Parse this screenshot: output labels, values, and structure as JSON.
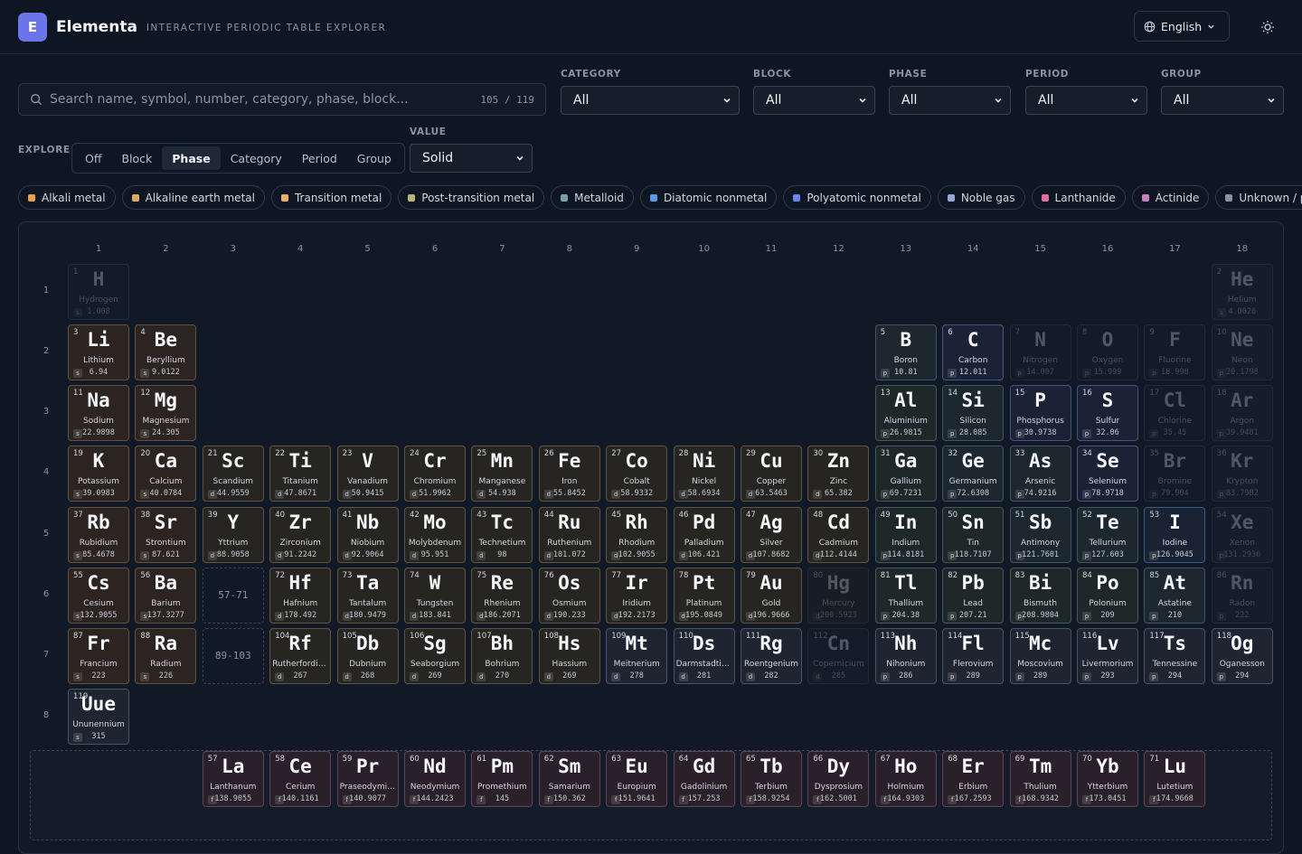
{
  "app": {
    "logo_letter": "E",
    "name": "Elementa",
    "tagline": "INTERACTIVE PERIODIC TABLE EXPLORER",
    "language": "English",
    "theme_icon": "sun-icon"
  },
  "search": {
    "placeholder": "Search name, symbol, number, category, phase, block...",
    "shown": "105",
    "sep": "/",
    "total": "119"
  },
  "filters": [
    {
      "label": "CATEGORY",
      "value": "All"
    },
    {
      "label": "BLOCK",
      "value": "All"
    },
    {
      "label": "PHASE",
      "value": "All"
    },
    {
      "label": "PERIOD",
      "value": "All"
    },
    {
      "label": "GROUP",
      "value": "All"
    }
  ],
  "explore": {
    "label": "EXPLORE",
    "options": [
      "Off",
      "Block",
      "Phase",
      "Category",
      "Period",
      "Group"
    ],
    "active": "Phase",
    "value_label": "VALUE",
    "value": "Solid"
  },
  "legend": [
    {
      "label": "Alkali metal",
      "color": "#e8a054"
    },
    {
      "label": "Alkaline earth metal",
      "color": "#e0a860"
    },
    {
      "label": "Transition metal",
      "color": "#e6b06a"
    },
    {
      "label": "Post-transition metal",
      "color": "#b7b576"
    },
    {
      "label": "Metalloid",
      "color": "#7e9bb0"
    },
    {
      "label": "Diatomic nonmetal",
      "color": "#5a9be6"
    },
    {
      "label": "Polyatomic nonmetal",
      "color": "#6a86e8"
    },
    {
      "label": "Noble gas",
      "color": "#9aa6d8"
    },
    {
      "label": "Lanthanide",
      "color": "#e06b9c"
    },
    {
      "label": "Actinide",
      "color": "#c97fbf"
    },
    {
      "label": "Unknown / predicted",
      "color": "#8b93a3"
    }
  ],
  "group_numbers": [
    "1",
    "2",
    "3",
    "4",
    "5",
    "6",
    "7",
    "8",
    "9",
    "10",
    "11",
    "12",
    "13",
    "14",
    "15",
    "16",
    "17",
    "18"
  ],
  "period_numbers": [
    "1",
    "2",
    "3",
    "4",
    "5",
    "6",
    "7",
    "8"
  ],
  "placeholders": [
    {
      "label": "57-71",
      "period": 6
    },
    {
      "label": "89-103",
      "period": 7
    }
  ],
  "elements": [
    {
      "z": "1",
      "sym": "H",
      "name": "Hydrogen",
      "mass": "1.008",
      "block": "s",
      "cat": "dnm",
      "g": 1,
      "p": 1,
      "dim": true
    },
    {
      "z": "2",
      "sym": "He",
      "name": "Helium",
      "mass": "4.0026",
      "block": "s",
      "cat": "noble",
      "g": 18,
      "p": 1,
      "dim": true
    },
    {
      "z": "3",
      "sym": "Li",
      "name": "Lithium",
      "mass": "6.94",
      "block": "s",
      "cat": "alk",
      "g": 1,
      "p": 2
    },
    {
      "z": "4",
      "sym": "Be",
      "name": "Beryllium",
      "mass": "9.0122",
      "block": "s",
      "cat": "ae",
      "g": 2,
      "p": 2
    },
    {
      "z": "5",
      "sym": "B",
      "name": "Boron",
      "mass": "10.81",
      "block": "p",
      "cat": "met",
      "g": 13,
      "p": 2
    },
    {
      "z": "6",
      "sym": "C",
      "name": "Carbon",
      "mass": "12.011",
      "block": "p",
      "cat": "pnm",
      "g": 14,
      "p": 2
    },
    {
      "z": "7",
      "sym": "N",
      "name": "Nitrogen",
      "mass": "14.007",
      "block": "p",
      "cat": "dnm",
      "g": 15,
      "p": 2,
      "dim": true
    },
    {
      "z": "8",
      "sym": "O",
      "name": "Oxygen",
      "mass": "15.999",
      "block": "p",
      "cat": "dnm",
      "g": 16,
      "p": 2,
      "dim": true
    },
    {
      "z": "9",
      "sym": "F",
      "name": "Fluorine",
      "mass": "18.998",
      "block": "p",
      "cat": "dnm",
      "g": 17,
      "p": 2,
      "dim": true
    },
    {
      "z": "10",
      "sym": "Ne",
      "name": "Neon",
      "mass": "20.1798",
      "block": "p",
      "cat": "noble",
      "g": 18,
      "p": 2,
      "dim": true
    },
    {
      "z": "11",
      "sym": "Na",
      "name": "Sodium",
      "mass": "22.9898",
      "block": "s",
      "cat": "alk",
      "g": 1,
      "p": 3
    },
    {
      "z": "12",
      "sym": "Mg",
      "name": "Magnesium",
      "mass": "24.305",
      "block": "s",
      "cat": "ae",
      "g": 2,
      "p": 3
    },
    {
      "z": "13",
      "sym": "Al",
      "name": "Aluminium",
      "mass": "26.9815",
      "block": "p",
      "cat": "post",
      "g": 13,
      "p": 3
    },
    {
      "z": "14",
      "sym": "Si",
      "name": "Silicon",
      "mass": "28.085",
      "block": "p",
      "cat": "met",
      "g": 14,
      "p": 3
    },
    {
      "z": "15",
      "sym": "P",
      "name": "Phosphorus",
      "mass": "30.9738",
      "block": "p",
      "cat": "pnm",
      "g": 15,
      "p": 3
    },
    {
      "z": "16",
      "sym": "S",
      "name": "Sulfur",
      "mass": "32.06",
      "block": "p",
      "cat": "pnm",
      "g": 16,
      "p": 3
    },
    {
      "z": "17",
      "sym": "Cl",
      "name": "Chlorine",
      "mass": "35.45",
      "block": "p",
      "cat": "dnm",
      "g": 17,
      "p": 3,
      "dim": true
    },
    {
      "z": "18",
      "sym": "Ar",
      "name": "Argon",
      "mass": "39.9481",
      "block": "p",
      "cat": "noble",
      "g": 18,
      "p": 3,
      "dim": true
    },
    {
      "z": "19",
      "sym": "K",
      "name": "Potassium",
      "mass": "39.0983",
      "block": "s",
      "cat": "alk",
      "g": 1,
      "p": 4
    },
    {
      "z": "20",
      "sym": "Ca",
      "name": "Calcium",
      "mass": "40.0784",
      "block": "s",
      "cat": "ae",
      "g": 2,
      "p": 4
    },
    {
      "z": "21",
      "sym": "Sc",
      "name": "Scandium",
      "mass": "44.9559",
      "block": "d",
      "cat": "tm",
      "g": 3,
      "p": 4
    },
    {
      "z": "22",
      "sym": "Ti",
      "name": "Titanium",
      "mass": "47.8671",
      "block": "d",
      "cat": "tm",
      "g": 4,
      "p": 4
    },
    {
      "z": "23",
      "sym": "V",
      "name": "Vanadium",
      "mass": "50.9415",
      "block": "d",
      "cat": "tm",
      "g": 5,
      "p": 4
    },
    {
      "z": "24",
      "sym": "Cr",
      "name": "Chromium",
      "mass": "51.9962",
      "block": "d",
      "cat": "tm",
      "g": 6,
      "p": 4
    },
    {
      "z": "25",
      "sym": "Mn",
      "name": "Manganese",
      "mass": "54.938",
      "block": "d",
      "cat": "tm",
      "g": 7,
      "p": 4
    },
    {
      "z": "26",
      "sym": "Fe",
      "name": "Iron",
      "mass": "55.8452",
      "block": "d",
      "cat": "tm",
      "g": 8,
      "p": 4
    },
    {
      "z": "27",
      "sym": "Co",
      "name": "Cobalt",
      "mass": "58.9332",
      "block": "d",
      "cat": "tm",
      "g": 9,
      "p": 4
    },
    {
      "z": "28",
      "sym": "Ni",
      "name": "Nickel",
      "mass": "58.6934",
      "block": "d",
      "cat": "tm",
      "g": 10,
      "p": 4
    },
    {
      "z": "29",
      "sym": "Cu",
      "name": "Copper",
      "mass": "63.5463",
      "block": "d",
      "cat": "tm",
      "g": 11,
      "p": 4
    },
    {
      "z": "30",
      "sym": "Zn",
      "name": "Zinc",
      "mass": "65.382",
      "block": "d",
      "cat": "tm",
      "g": 12,
      "p": 4
    },
    {
      "z": "31",
      "sym": "Ga",
      "name": "Gallium",
      "mass": "69.7231",
      "block": "p",
      "cat": "post",
      "g": 13,
      "p": 4
    },
    {
      "z": "32",
      "sym": "Ge",
      "name": "Germanium",
      "mass": "72.6308",
      "block": "p",
      "cat": "met",
      "g": 14,
      "p": 4
    },
    {
      "z": "33",
      "sym": "As",
      "name": "Arsenic",
      "mass": "74.9216",
      "block": "p",
      "cat": "met",
      "g": 15,
      "p": 4
    },
    {
      "z": "34",
      "sym": "Se",
      "name": "Selenium",
      "mass": "78.9718",
      "block": "p",
      "cat": "pnm",
      "g": 16,
      "p": 4
    },
    {
      "z": "35",
      "sym": "Br",
      "name": "Bromine",
      "mass": "79.904",
      "block": "p",
      "cat": "dnm",
      "g": 17,
      "p": 4,
      "dim": true
    },
    {
      "z": "36",
      "sym": "Kr",
      "name": "Krypton",
      "mass": "83.7982",
      "block": "p",
      "cat": "noble",
      "g": 18,
      "p": 4,
      "dim": true
    },
    {
      "z": "37",
      "sym": "Rb",
      "name": "Rubidium",
      "mass": "85.4678",
      "block": "s",
      "cat": "alk",
      "g": 1,
      "p": 5
    },
    {
      "z": "38",
      "sym": "Sr",
      "name": "Strontium",
      "mass": "87.621",
      "block": "s",
      "cat": "ae",
      "g": 2,
      "p": 5
    },
    {
      "z": "39",
      "sym": "Y",
      "name": "Yttrium",
      "mass": "88.9058",
      "block": "d",
      "cat": "tm",
      "g": 3,
      "p": 5
    },
    {
      "z": "40",
      "sym": "Zr",
      "name": "Zirconium",
      "mass": "91.2242",
      "block": "d",
      "cat": "tm",
      "g": 4,
      "p": 5
    },
    {
      "z": "41",
      "sym": "Nb",
      "name": "Niobium",
      "mass": "92.9064",
      "block": "d",
      "cat": "tm",
      "g": 5,
      "p": 5
    },
    {
      "z": "42",
      "sym": "Mo",
      "name": "Molybdenum",
      "mass": "95.951",
      "block": "d",
      "cat": "tm",
      "g": 6,
      "p": 5
    },
    {
      "z": "43",
      "sym": "Tc",
      "name": "Technetium",
      "mass": "98",
      "block": "d",
      "cat": "tm",
      "g": 7,
      "p": 5
    },
    {
      "z": "44",
      "sym": "Ru",
      "name": "Ruthenium",
      "mass": "101.072",
      "block": "d",
      "cat": "tm",
      "g": 8,
      "p": 5
    },
    {
      "z": "45",
      "sym": "Rh",
      "name": "Rhodium",
      "mass": "102.9055",
      "block": "d",
      "cat": "tm",
      "g": 9,
      "p": 5
    },
    {
      "z": "46",
      "sym": "Pd",
      "name": "Palladium",
      "mass": "106.421",
      "block": "d",
      "cat": "tm",
      "g": 10,
      "p": 5
    },
    {
      "z": "47",
      "sym": "Ag",
      "name": "Silver",
      "mass": "107.8682",
      "block": "d",
      "cat": "tm",
      "g": 11,
      "p": 5
    },
    {
      "z": "48",
      "sym": "Cd",
      "name": "Cadmium",
      "mass": "112.4144",
      "block": "d",
      "cat": "tm",
      "g": 12,
      "p": 5
    },
    {
      "z": "49",
      "sym": "In",
      "name": "Indium",
      "mass": "114.8181",
      "block": "p",
      "cat": "post",
      "g": 13,
      "p": 5
    },
    {
      "z": "50",
      "sym": "Sn",
      "name": "Tin",
      "mass": "118.7107",
      "block": "p",
      "cat": "post",
      "g": 14,
      "p": 5
    },
    {
      "z": "51",
      "sym": "Sb",
      "name": "Antimony",
      "mass": "121.7601",
      "block": "p",
      "cat": "met",
      "g": 15,
      "p": 5
    },
    {
      "z": "52",
      "sym": "Te",
      "name": "Tellurium",
      "mass": "127.603",
      "block": "p",
      "cat": "met",
      "g": 16,
      "p": 5
    },
    {
      "z": "53",
      "sym": "I",
      "name": "Iodine",
      "mass": "126.9045",
      "block": "p",
      "cat": "dnm",
      "g": 17,
      "p": 5
    },
    {
      "z": "54",
      "sym": "Xe",
      "name": "Xenon",
      "mass": "131.2936",
      "block": "p",
      "cat": "noble",
      "g": 18,
      "p": 5,
      "dim": true
    },
    {
      "z": "55",
      "sym": "Cs",
      "name": "Cesium",
      "mass": "132.9055",
      "block": "s",
      "cat": "alk",
      "g": 1,
      "p": 6
    },
    {
      "z": "56",
      "sym": "Ba",
      "name": "Barium",
      "mass": "137.3277",
      "block": "s",
      "cat": "ae",
      "g": 2,
      "p": 6
    },
    {
      "z": "72",
      "sym": "Hf",
      "name": "Hafnium",
      "mass": "178.492",
      "block": "d",
      "cat": "tm",
      "g": 4,
      "p": 6
    },
    {
      "z": "73",
      "sym": "Ta",
      "name": "Tantalum",
      "mass": "180.9479",
      "block": "d",
      "cat": "tm",
      "g": 5,
      "p": 6
    },
    {
      "z": "74",
      "sym": "W",
      "name": "Tungsten",
      "mass": "183.841",
      "block": "d",
      "cat": "tm",
      "g": 6,
      "p": 6
    },
    {
      "z": "75",
      "sym": "Re",
      "name": "Rhenium",
      "mass": "186.2071",
      "block": "d",
      "cat": "tm",
      "g": 7,
      "p": 6
    },
    {
      "z": "76",
      "sym": "Os",
      "name": "Osmium",
      "mass": "190.233",
      "block": "d",
      "cat": "tm",
      "g": 8,
      "p": 6
    },
    {
      "z": "77",
      "sym": "Ir",
      "name": "Iridium",
      "mass": "192.2173",
      "block": "d",
      "cat": "tm",
      "g": 9,
      "p": 6
    },
    {
      "z": "78",
      "sym": "Pt",
      "name": "Platinum",
      "mass": "195.0849",
      "block": "d",
      "cat": "tm",
      "g": 10,
      "p": 6
    },
    {
      "z": "79",
      "sym": "Au",
      "name": "Gold",
      "mass": "196.9666",
      "block": "d",
      "cat": "tm",
      "g": 11,
      "p": 6
    },
    {
      "z": "80",
      "sym": "Hg",
      "name": "Mercury",
      "mass": "200.5923",
      "block": "d",
      "cat": "tm",
      "g": 12,
      "p": 6,
      "dim": true
    },
    {
      "z": "81",
      "sym": "Tl",
      "name": "Thallium",
      "mass": "204.38",
      "block": "p",
      "cat": "post",
      "g": 13,
      "p": 6
    },
    {
      "z": "82",
      "sym": "Pb",
      "name": "Lead",
      "mass": "207.21",
      "block": "p",
      "cat": "post",
      "g": 14,
      "p": 6
    },
    {
      "z": "83",
      "sym": "Bi",
      "name": "Bismuth",
      "mass": "208.9804",
      "block": "p",
      "cat": "post",
      "g": 15,
      "p": 6
    },
    {
      "z": "84",
      "sym": "Po",
      "name": "Polonium",
      "mass": "209",
      "block": "p",
      "cat": "post",
      "g": 16,
      "p": 6
    },
    {
      "z": "85",
      "sym": "At",
      "name": "Astatine",
      "mass": "210",
      "block": "p",
      "cat": "met",
      "g": 17,
      "p": 6
    },
    {
      "z": "86",
      "sym": "Rn",
      "name": "Radon",
      "mass": "222",
      "block": "p",
      "cat": "noble",
      "g": 18,
      "p": 6,
      "dim": true
    },
    {
      "z": "87",
      "sym": "Fr",
      "name": "Francium",
      "mass": "223",
      "block": "s",
      "cat": "alk",
      "g": 1,
      "p": 7
    },
    {
      "z": "88",
      "sym": "Ra",
      "name": "Radium",
      "mass": "226",
      "block": "s",
      "cat": "ae",
      "g": 2,
      "p": 7
    },
    {
      "z": "104",
      "sym": "Rf",
      "name": "Rutherfordium",
      "mass": "267",
      "block": "d",
      "cat": "tm",
      "g": 4,
      "p": 7
    },
    {
      "z": "105",
      "sym": "Db",
      "name": "Dubnium",
      "mass": "268",
      "block": "d",
      "cat": "tm",
      "g": 5,
      "p": 7
    },
    {
      "z": "106",
      "sym": "Sg",
      "name": "Seaborgium",
      "mass": "269",
      "block": "d",
      "cat": "tm",
      "g": 6,
      "p": 7
    },
    {
      "z": "107",
      "sym": "Bh",
      "name": "Bohrium",
      "mass": "270",
      "block": "d",
      "cat": "tm",
      "g": 7,
      "p": 7
    },
    {
      "z": "108",
      "sym": "Hs",
      "name": "Hassium",
      "mass": "269",
      "block": "d",
      "cat": "tm",
      "g": 8,
      "p": 7
    },
    {
      "z": "109",
      "sym": "Mt",
      "name": "Meitnerium",
      "mass": "278",
      "block": "d",
      "cat": "unk",
      "g": 9,
      "p": 7
    },
    {
      "z": "110",
      "sym": "Ds",
      "name": "Darmstadtium",
      "mass": "281",
      "block": "d",
      "cat": "unk",
      "g": 10,
      "p": 7
    },
    {
      "z": "111",
      "sym": "Rg",
      "name": "Roentgenium",
      "mass": "282",
      "block": "d",
      "cat": "unk",
      "g": 11,
      "p": 7
    },
    {
      "z": "112",
      "sym": "Cn",
      "name": "Copernicium",
      "mass": "285",
      "block": "d",
      "cat": "unk",
      "g": 12,
      "p": 7,
      "dim": true
    },
    {
      "z": "113",
      "sym": "Nh",
      "name": "Nihonium",
      "mass": "286",
      "block": "p",
      "cat": "unk",
      "g": 13,
      "p": 7
    },
    {
      "z": "114",
      "sym": "Fl",
      "name": "Flerovium",
      "mass": "289",
      "block": "p",
      "cat": "unk",
      "g": 14,
      "p": 7
    },
    {
      "z": "115",
      "sym": "Mc",
      "name": "Moscovium",
      "mass": "289",
      "block": "p",
      "cat": "unk",
      "g": 15,
      "p": 7
    },
    {
      "z": "116",
      "sym": "Lv",
      "name": "Livermorium",
      "mass": "293",
      "block": "p",
      "cat": "unk",
      "g": 16,
      "p": 7
    },
    {
      "z": "117",
      "sym": "Ts",
      "name": "Tennessine",
      "mass": "294",
      "block": "p",
      "cat": "unk",
      "g": 17,
      "p": 7
    },
    {
      "z": "118",
      "sym": "Og",
      "name": "Oganesson",
      "mass": "294",
      "block": "p",
      "cat": "unk",
      "g": 18,
      "p": 7
    },
    {
      "z": "119",
      "sym": "Uue",
      "name": "Ununennium",
      "mass": "315",
      "block": "s",
      "cat": "unk",
      "g": 1,
      "p": 8
    },
    {
      "z": "57",
      "sym": "La",
      "name": "Lanthanum",
      "mass": "138.9055",
      "block": "f",
      "cat": "lan",
      "g": 3,
      "p": 9
    },
    {
      "z": "58",
      "sym": "Ce",
      "name": "Cerium",
      "mass": "140.1161",
      "block": "f",
      "cat": "lan",
      "g": 4,
      "p": 9
    },
    {
      "z": "59",
      "sym": "Pr",
      "name": "Praseodymium",
      "mass": "140.9077",
      "block": "f",
      "cat": "lan",
      "g": 5,
      "p": 9
    },
    {
      "z": "60",
      "sym": "Nd",
      "name": "Neodymium",
      "mass": "144.2423",
      "block": "f",
      "cat": "lan",
      "g": 6,
      "p": 9
    },
    {
      "z": "61",
      "sym": "Pm",
      "name": "Promethium",
      "mass": "145",
      "block": "f",
      "cat": "lan",
      "g": 7,
      "p": 9
    },
    {
      "z": "62",
      "sym": "Sm",
      "name": "Samarium",
      "mass": "150.362",
      "block": "f",
      "cat": "lan",
      "g": 8,
      "p": 9
    },
    {
      "z": "63",
      "sym": "Eu",
      "name": "Europium",
      "mass": "151.9641",
      "block": "f",
      "cat": "lan",
      "g": 9,
      "p": 9
    },
    {
      "z": "64",
      "sym": "Gd",
      "name": "Gadolinium",
      "mass": "157.253",
      "block": "f",
      "cat": "lan",
      "g": 10,
      "p": 9
    },
    {
      "z": "65",
      "sym": "Tb",
      "name": "Terbium",
      "mass": "158.9254",
      "block": "f",
      "cat": "lan",
      "g": 11,
      "p": 9
    },
    {
      "z": "66",
      "sym": "Dy",
      "name": "Dysprosium",
      "mass": "162.5001",
      "block": "f",
      "cat": "lan",
      "g": 12,
      "p": 9
    },
    {
      "z": "67",
      "sym": "Ho",
      "name": "Holmium",
      "mass": "164.9303",
      "block": "f",
      "cat": "lan",
      "g": 13,
      "p": 9
    },
    {
      "z": "68",
      "sym": "Er",
      "name": "Erbium",
      "mass": "167.2593",
      "block": "f",
      "cat": "lan",
      "g": 14,
      "p": 9
    },
    {
      "z": "69",
      "sym": "Tm",
      "name": "Thulium",
      "mass": "168.9342",
      "block": "f",
      "cat": "lan",
      "g": 15,
      "p": 9
    },
    {
      "z": "70",
      "sym": "Yb",
      "name": "Ytterbium",
      "mass": "173.0451",
      "block": "f",
      "cat": "lan",
      "g": 16,
      "p": 9
    },
    {
      "z": "71",
      "sym": "Lu",
      "name": "Lutetium",
      "mass": "174.9668",
      "block": "f",
      "cat": "lan",
      "g": 17,
      "p": 9
    }
  ]
}
